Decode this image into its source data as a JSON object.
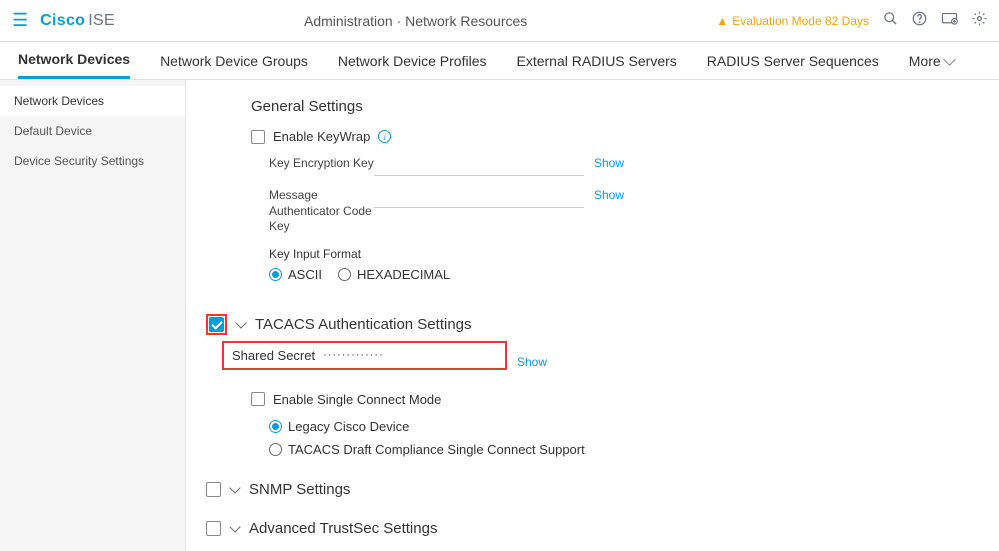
{
  "header": {
    "brand_main": "Cisco",
    "brand_sub": "ISE",
    "breadcrumb": "Administration · Network Resources",
    "eval_text": "Evaluation Mode 82 Days"
  },
  "tabs": [
    {
      "label": "Network Devices",
      "active": true
    },
    {
      "label": "Network Device Groups"
    },
    {
      "label": "Network Device Profiles"
    },
    {
      "label": "External RADIUS Servers"
    },
    {
      "label": "RADIUS Server Sequences"
    },
    {
      "label": "More"
    }
  ],
  "sidebar": [
    {
      "label": "Network Devices",
      "active": true
    },
    {
      "label": "Default Device"
    },
    {
      "label": "Device Security Settings"
    }
  ],
  "general": {
    "title": "General Settings",
    "enable_keywrap": "Enable KeyWrap",
    "key_enc": "Key Encryption Key",
    "msg_auth": "Message Authenticator Code Key",
    "key_input_format": "Key Input Format",
    "ascii": "ASCII",
    "hex": "HEXADECIMAL",
    "show": "Show"
  },
  "tacacs": {
    "title": "TACACS Authentication Settings",
    "shared_secret_label": "Shared Secret",
    "shared_secret_value": "·············",
    "show": "Show",
    "single_connect": "Enable Single Connect Mode",
    "legacy": "Legacy Cisco Device",
    "draft": "TACACS Draft Compliance Single Connect Support"
  },
  "snmp": {
    "title": "SNMP Settings"
  },
  "advanced": {
    "title": "Advanced TrustSec Settings"
  }
}
